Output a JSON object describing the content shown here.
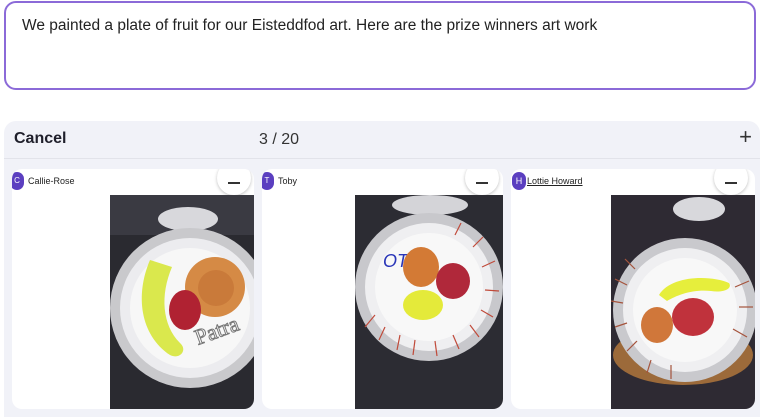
{
  "post": {
    "text": "We painted a plate of fruit for our Eisteddfod art. Here are the prize winners art work"
  },
  "gallery": {
    "cancel_label": "Cancel",
    "counter": "3 / 20",
    "add_icon": "plus-icon",
    "cards": [
      {
        "initial": "C",
        "name": "Callie-Rose",
        "remove_icon": "minus-icon"
      },
      {
        "initial": "T",
        "name": "Toby",
        "remove_icon": "minus-icon"
      },
      {
        "initial": "H",
        "name": "Lottie Howard",
        "remove_icon": "minus-icon"
      }
    ]
  }
}
